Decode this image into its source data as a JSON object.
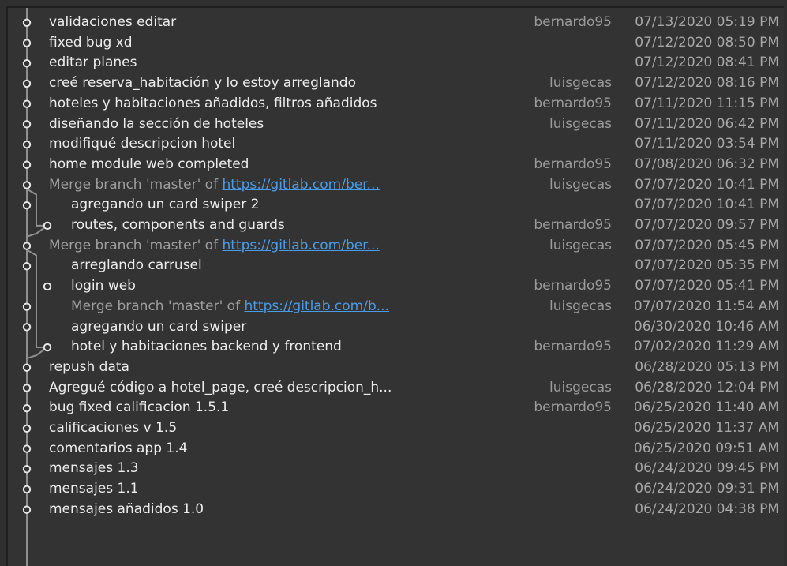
{
  "commits": [
    {
      "message": "validaciones editar",
      "author": "bernardo95",
      "date": "07/13/2020 05:19 PM"
    },
    {
      "message": "fixed bug xd",
      "author": "",
      "date": "07/12/2020 08:50 PM"
    },
    {
      "message": "editar planes",
      "author": "",
      "date": "07/12/2020 08:41 PM"
    },
    {
      "message": "creé reserva_habitación y lo estoy arreglando",
      "author": "luisgecas",
      "date": "07/12/2020 08:16 PM"
    },
    {
      "message": "hoteles y habitaciones añadidos, filtros añadidos",
      "author": "bernardo95",
      "date": "07/11/2020 11:15 PM"
    },
    {
      "message": "diseñando la sección de hoteles",
      "author": "luisgecas",
      "date": "07/11/2020 06:42 PM"
    },
    {
      "message": "modifiqué descripcion hotel",
      "author": "",
      "date": "07/11/2020 03:54 PM"
    },
    {
      "message": "home module web completed",
      "author": "bernardo95",
      "date": "07/08/2020 06:32 PM"
    },
    {
      "message": "Merge branch 'master' of ",
      "link": "https://gitlab.com/ber...",
      "merge": true,
      "author": "luisgecas",
      "date": "07/07/2020 10:41 PM"
    },
    {
      "message": "agregando un card swiper 2",
      "indent": true,
      "author": "",
      "date": "07/07/2020 10:41 PM"
    },
    {
      "message": "routes, components and guards",
      "indent": true,
      "author": "bernardo95",
      "date": "07/07/2020 09:57 PM"
    },
    {
      "message": "Merge branch 'master' of ",
      "link": "https://gitlab.com/ber...",
      "merge": true,
      "author": "luisgecas",
      "date": "07/07/2020 05:45 PM"
    },
    {
      "message": "arreglando carrusel",
      "indent": true,
      "author": "",
      "date": "07/07/2020 05:35 PM"
    },
    {
      "message": "login web",
      "indent": true,
      "author": "bernardo95",
      "date": "07/07/2020 05:41 PM"
    },
    {
      "message": "Merge branch 'master' of ",
      "link": "https://gitlab.com/b...",
      "merge": true,
      "indent": true,
      "author": "luisgecas",
      "date": "07/07/2020 11:54 AM"
    },
    {
      "message": "agregando un card swiper",
      "indent": true,
      "author": "",
      "date": "06/30/2020 10:46 AM"
    },
    {
      "message": "hotel y habitaciones backend y frontend",
      "indent": true,
      "author": "bernardo95",
      "date": "07/02/2020 11:29 AM"
    },
    {
      "message": "repush data",
      "author": "",
      "date": "06/28/2020 05:13 PM"
    },
    {
      "message": "Agregué código a hotel_page, creé descripcion_h...",
      "author": "luisgecas",
      "date": "06/28/2020 12:04 PM"
    },
    {
      "message": "bug fixed calificacion 1.5.1",
      "author": "bernardo95",
      "date": "06/25/2020 11:40 AM"
    },
    {
      "message": "calificaciones v 1.5",
      "author": "",
      "date": "06/25/2020 11:37 AM"
    },
    {
      "message": "comentarios app 1.4",
      "author": "",
      "date": "06/25/2020 09:51 AM"
    },
    {
      "message": "mensajes 1.3",
      "author": "",
      "date": "06/24/2020 09:45 PM"
    },
    {
      "message": "mensajes 1.1",
      "author": "",
      "date": "06/24/2020 09:31 PM"
    },
    {
      "message": "mensajes añadidos 1.0",
      "author": "",
      "date": "06/24/2020 04:38 PM"
    }
  ]
}
